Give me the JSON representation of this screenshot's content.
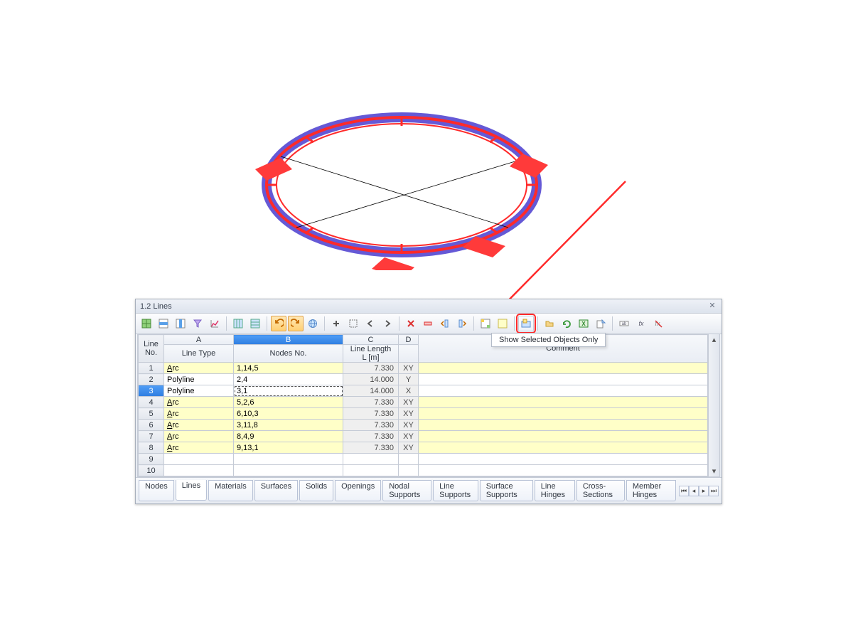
{
  "panel": {
    "title": "1.2 Lines",
    "tooltip": "Show Selected Objects Only"
  },
  "columns": {
    "rowhead1": "Line",
    "rowhead2": "No.",
    "syms": [
      "A",
      "B",
      "C",
      "D"
    ],
    "A": "Line Type",
    "B": "Nodes No.",
    "C1": "Line Length",
    "C2": "L [m]",
    "D": "",
    "E": "Comment"
  },
  "rows": [
    {
      "n": "1",
      "type": "Arc",
      "nodes": "1,14,5",
      "len": "7.330",
      "ax": "XY",
      "hl": true
    },
    {
      "n": "2",
      "type": "Polyline",
      "nodes": "2,4",
      "len": "14.000",
      "ax": "Y",
      "hl": false
    },
    {
      "n": "3",
      "type": "Polyline",
      "nodes": "3,1",
      "len": "14.000",
      "ax": "X",
      "hl": false,
      "sel": true,
      "editing": true
    },
    {
      "n": "4",
      "type": "Arc",
      "nodes": "5,2,6",
      "len": "7.330",
      "ax": "XY",
      "hl": true
    },
    {
      "n": "5",
      "type": "Arc",
      "nodes": "6,10,3",
      "len": "7.330",
      "ax": "XY",
      "hl": true
    },
    {
      "n": "6",
      "type": "Arc",
      "nodes": "3,11,8",
      "len": "7.330",
      "ax": "XY",
      "hl": true
    },
    {
      "n": "7",
      "type": "Arc",
      "nodes": "8,4,9",
      "len": "7.330",
      "ax": "XY",
      "hl": true
    },
    {
      "n": "8",
      "type": "Arc",
      "nodes": "9,13,1",
      "len": "7.330",
      "ax": "XY",
      "hl": true
    },
    {
      "n": "9",
      "type": "",
      "nodes": "",
      "len": "",
      "ax": "",
      "hl": false
    },
    {
      "n": "10",
      "type": "",
      "nodes": "",
      "len": "",
      "ax": "",
      "hl": false
    }
  ],
  "tabs": [
    "Nodes",
    "Lines",
    "Materials",
    "Surfaces",
    "Solids",
    "Openings",
    "Nodal Supports",
    "Line Supports",
    "Surface Supports",
    "Line Hinges",
    "Cross-Sections",
    "Member Hinges"
  ],
  "active_tab": 1,
  "toolbar_icons": [
    "table-green-icon",
    "goto-row-icon",
    "goto-col-icon",
    "filter-icon",
    "chart-icon",
    "sep",
    "grid-fill-icon",
    "grid-align-icon",
    "sep",
    "undo-icon",
    "redo-icon",
    "globe-icon",
    "sep",
    "plus-icon",
    "select-all-icon",
    "nav-left-icon",
    "nav-right-icon",
    "sep",
    "delete-x-icon",
    "clear-row-icon",
    "col-left-icon",
    "col-right-icon",
    "sep",
    "palette-icon",
    "highlight-icon",
    "sep",
    "show-selected-icon",
    "sep",
    "open-folder-icon",
    "refresh-green-icon",
    "excel-icon",
    "export-icon",
    "sep",
    "rename-icon",
    "fx-icon",
    "fx-delete-icon"
  ]
}
